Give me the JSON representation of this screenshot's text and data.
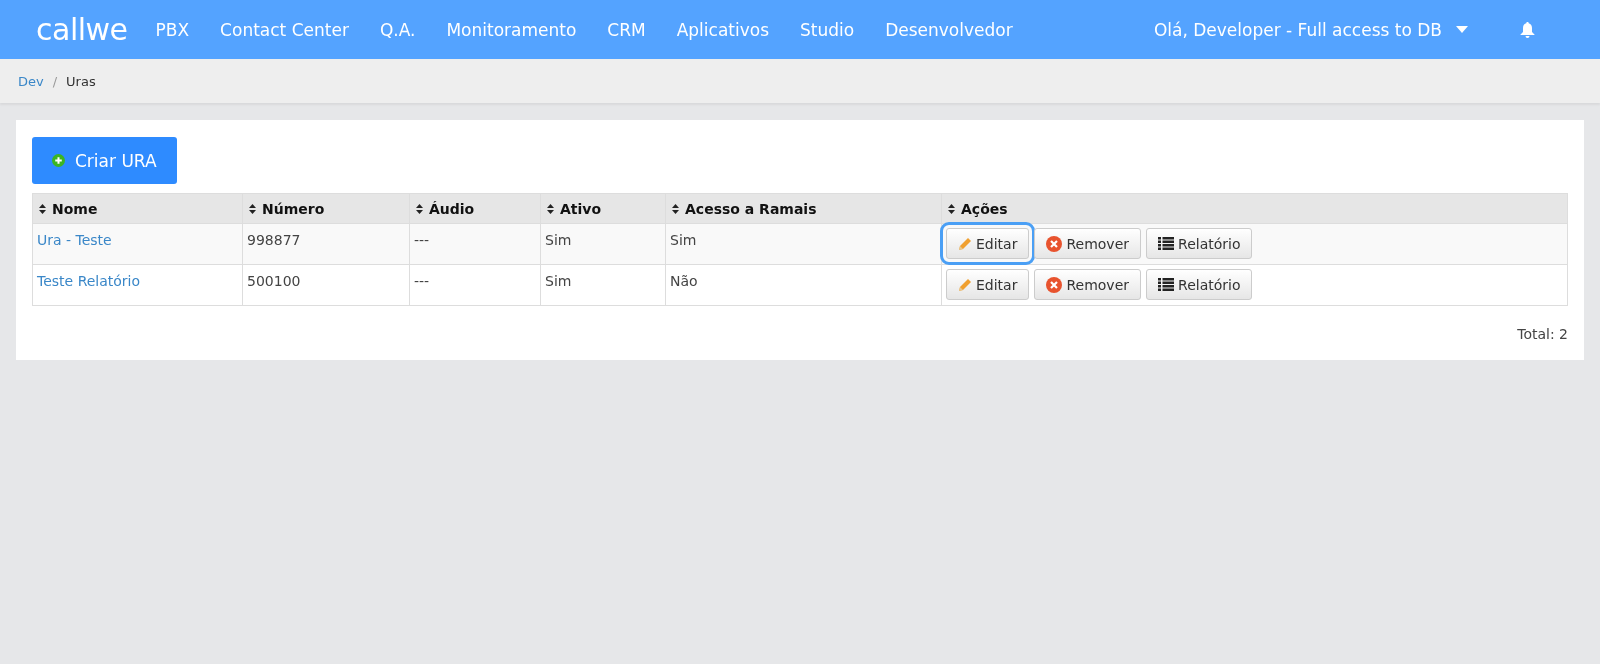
{
  "navbar": {
    "logo": "callwe",
    "menu": [
      "PBX",
      "Contact Center",
      "Q.A.",
      "Monitoramento",
      "CRM",
      "Aplicativos",
      "Studio",
      "Desenvolvedor"
    ],
    "user": "Olá, Developer - Full access to DB"
  },
  "breadcrumb_separator": "/",
  "breadcrumb": [
    {
      "label": "Dev",
      "link": true
    },
    {
      "label": "Uras",
      "link": false
    }
  ],
  "create_button": "Criar URA",
  "table": {
    "columns": [
      "Nome",
      "Número",
      "Áudio",
      "Ativo",
      "Acesso a Ramais",
      "Ações"
    ],
    "rows": [
      {
        "cells": [
          "Ura - Teste",
          "998877",
          "---",
          "Sim",
          "Sim"
        ],
        "actions": [
          {
            "kind": "edit",
            "label": "Editar",
            "focused": true
          },
          {
            "kind": "remove",
            "label": "Remover",
            "focused": false
          },
          {
            "kind": "report",
            "label": "Relatório",
            "focused": false
          }
        ]
      },
      {
        "cells": [
          "Teste Relatório",
          "500100",
          "---",
          "Sim",
          "Não"
        ],
        "actions": [
          {
            "kind": "edit",
            "label": "Editar",
            "focused": false
          },
          {
            "kind": "remove",
            "label": "Remover",
            "focused": false
          },
          {
            "kind": "report",
            "label": "Relatório",
            "focused": false
          }
        ]
      }
    ]
  },
  "total": "Total: 2"
}
